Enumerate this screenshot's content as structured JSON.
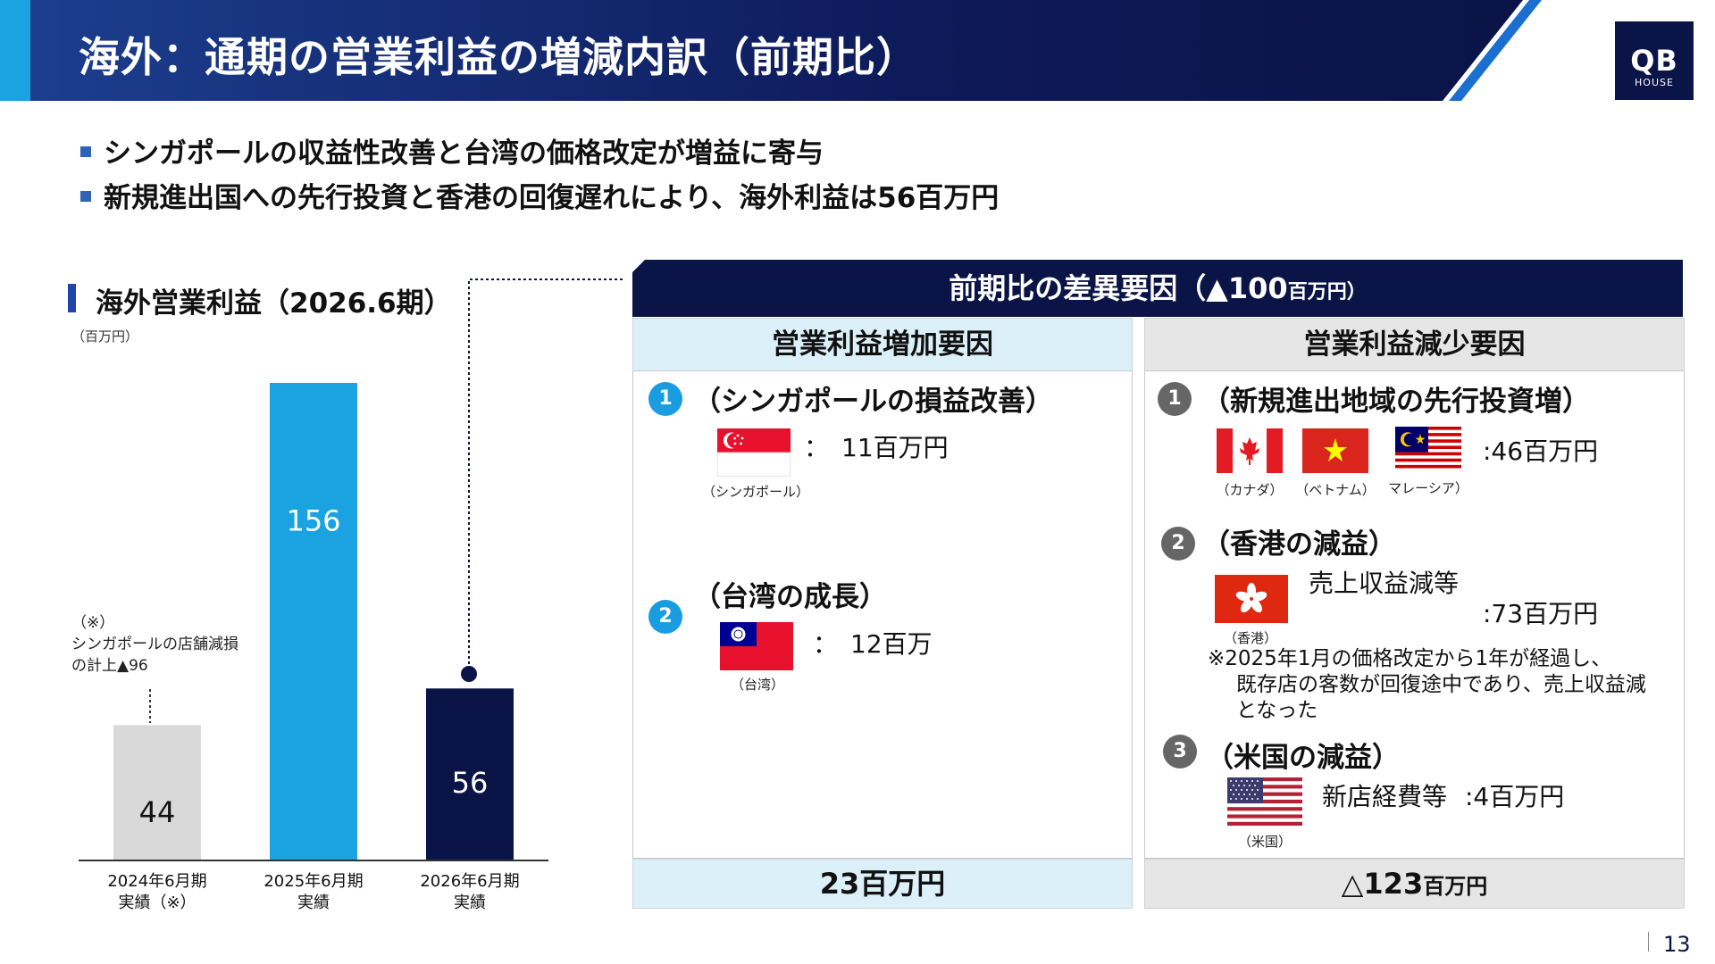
{
  "header": {
    "title": "海外：通期の営業利益の増減内訳（前期比）",
    "logo_line1": "QB",
    "logo_line2": "HOUSE"
  },
  "bullets": [
    "シンガポールの収益性改善と台湾の価格改定が増益に寄与",
    "新規進出国への先行投資と香港の回復遅れにより、海外利益は56百万円"
  ],
  "chart": {
    "title": "海外営業利益（2026.6期）",
    "unit": "（百万円）",
    "note_lines": [
      "（※）",
      "シンガポールの店舗減損",
      "の計上▲96"
    ]
  },
  "chart_data": {
    "type": "bar",
    "title": "海外営業利益（2026.6期）",
    "ylabel": "（百万円）",
    "categories": [
      {
        "line1": "2024年6月期",
        "line2": "実績（※）"
      },
      {
        "line1": "2025年6月期",
        "line2": "実績"
      },
      {
        "line1": "2026年6月期",
        "line2": "実績"
      }
    ],
    "values": [
      44,
      156,
      56
    ],
    "value_labels": [
      "44",
      "156",
      "56"
    ],
    "colors": [
      "#d9d9d9",
      "#1aa3e0",
      "#0b1446"
    ],
    "label_colors": [
      "#111111",
      "#ffffff",
      "#ffffff"
    ],
    "ylim": [
      0,
      160
    ]
  },
  "panel": {
    "header_main": "前期比の差異要因",
    "header_paren_open": "（▲100",
    "header_unit": "百万円）",
    "increase": {
      "title": "営業利益増加要因",
      "total_value": "23百万円",
      "items": [
        {
          "num": "1",
          "title": "（シンガポールの損益改善）",
          "value": "：　11百万円",
          "flag_caption": "（シンガポール）"
        },
        {
          "num": "2",
          "title": "（台湾の成長）",
          "value": "：　12百万",
          "flag_caption": "（台湾）"
        }
      ]
    },
    "decrease": {
      "title": "営業利益減少要因",
      "total_value": "△123",
      "total_unit": "百万円",
      "items": [
        {
          "num": "1",
          "title": "（新規進出地域の先行投資増）",
          "value": ":46百万円",
          "flag_captions": [
            "（カナダ）",
            "（ベトナム）",
            "マレーシア）"
          ]
        },
        {
          "num": "2",
          "title": "（香港の減益）",
          "value_label": "売上収益減等",
          "value": ":73百万円",
          "flag_caption": "（香港）",
          "note_lines": [
            "※2025年1月の価格改定から1年が経過し、",
            "既存店の客数が回復途中であり、売上収益減",
            "となった"
          ]
        },
        {
          "num": "3",
          "title": "（米国の減益）",
          "value_label": "新店経費等",
          "value": ":4百万円",
          "flag_caption": "（米国）"
        }
      ]
    }
  },
  "footer": {
    "page_number": "13"
  },
  "colors": {
    "navy": "#0b1446",
    "blue": "#1aa3e0",
    "light_blue": "#dcf0fa",
    "gray": "#e6e6e6"
  }
}
